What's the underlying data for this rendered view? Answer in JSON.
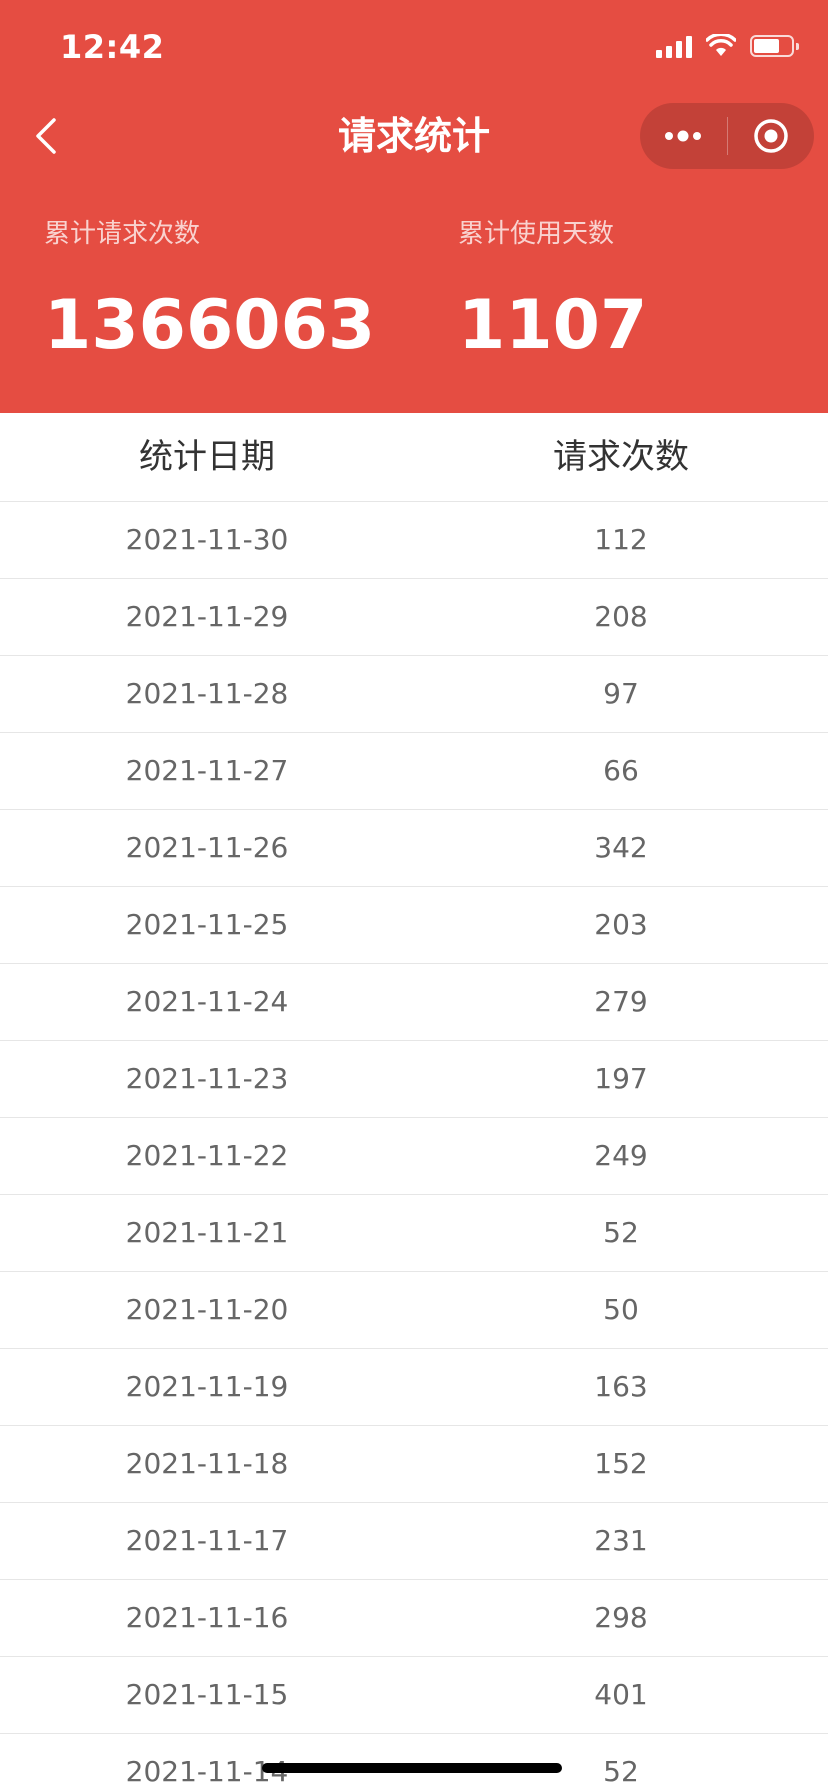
{
  "status_bar": {
    "time": "12:42"
  },
  "nav": {
    "title": "请求统计",
    "back_icon": "chevron-left-icon",
    "more_icon": "more-dots-icon",
    "close_icon": "target-close-icon"
  },
  "summary": {
    "total_requests_label": "累计请求次数",
    "total_requests_value": "1366063",
    "total_days_label": "累计使用天数",
    "total_days_value": "1107"
  },
  "table": {
    "headers": [
      "统计日期",
      "请求次数"
    ],
    "rows": [
      {
        "date": "2021-11-30",
        "count": "112"
      },
      {
        "date": "2021-11-29",
        "count": "208"
      },
      {
        "date": "2021-11-28",
        "count": "97"
      },
      {
        "date": "2021-11-27",
        "count": "66"
      },
      {
        "date": "2021-11-26",
        "count": "342"
      },
      {
        "date": "2021-11-25",
        "count": "203"
      },
      {
        "date": "2021-11-24",
        "count": "279"
      },
      {
        "date": "2021-11-23",
        "count": "197"
      },
      {
        "date": "2021-11-22",
        "count": "249"
      },
      {
        "date": "2021-11-21",
        "count": "52"
      },
      {
        "date": "2021-11-20",
        "count": "50"
      },
      {
        "date": "2021-11-19",
        "count": "163"
      },
      {
        "date": "2021-11-18",
        "count": "152"
      },
      {
        "date": "2021-11-17",
        "count": "231"
      },
      {
        "date": "2021-11-16",
        "count": "298"
      },
      {
        "date": "2021-11-15",
        "count": "401"
      },
      {
        "date": "2021-11-14",
        "count": "52"
      }
    ]
  },
  "colors": {
    "header_bg": "#E54D42",
    "header_text": "#FFFFFF",
    "cell_text": "#666666",
    "header_cell_text": "#333333",
    "divider": "#E6E6E6"
  }
}
